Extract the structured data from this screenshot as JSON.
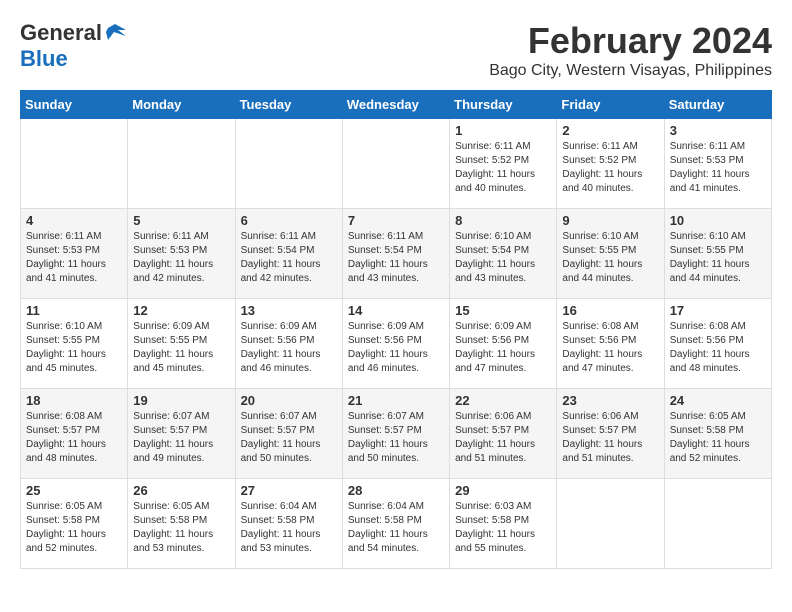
{
  "header": {
    "logo_general": "General",
    "logo_blue": "Blue",
    "month_title": "February 2024",
    "location": "Bago City, Western Visayas, Philippines"
  },
  "days_of_week": [
    "Sunday",
    "Monday",
    "Tuesday",
    "Wednesday",
    "Thursday",
    "Friday",
    "Saturday"
  ],
  "weeks": [
    [
      {
        "day": "",
        "info": ""
      },
      {
        "day": "",
        "info": ""
      },
      {
        "day": "",
        "info": ""
      },
      {
        "day": "",
        "info": ""
      },
      {
        "day": "1",
        "info": "Sunrise: 6:11 AM\nSunset: 5:52 PM\nDaylight: 11 hours\nand 40 minutes."
      },
      {
        "day": "2",
        "info": "Sunrise: 6:11 AM\nSunset: 5:52 PM\nDaylight: 11 hours\nand 40 minutes."
      },
      {
        "day": "3",
        "info": "Sunrise: 6:11 AM\nSunset: 5:53 PM\nDaylight: 11 hours\nand 41 minutes."
      }
    ],
    [
      {
        "day": "4",
        "info": "Sunrise: 6:11 AM\nSunset: 5:53 PM\nDaylight: 11 hours\nand 41 minutes."
      },
      {
        "day": "5",
        "info": "Sunrise: 6:11 AM\nSunset: 5:53 PM\nDaylight: 11 hours\nand 42 minutes."
      },
      {
        "day": "6",
        "info": "Sunrise: 6:11 AM\nSunset: 5:54 PM\nDaylight: 11 hours\nand 42 minutes."
      },
      {
        "day": "7",
        "info": "Sunrise: 6:11 AM\nSunset: 5:54 PM\nDaylight: 11 hours\nand 43 minutes."
      },
      {
        "day": "8",
        "info": "Sunrise: 6:10 AM\nSunset: 5:54 PM\nDaylight: 11 hours\nand 43 minutes."
      },
      {
        "day": "9",
        "info": "Sunrise: 6:10 AM\nSunset: 5:55 PM\nDaylight: 11 hours\nand 44 minutes."
      },
      {
        "day": "10",
        "info": "Sunrise: 6:10 AM\nSunset: 5:55 PM\nDaylight: 11 hours\nand 44 minutes."
      }
    ],
    [
      {
        "day": "11",
        "info": "Sunrise: 6:10 AM\nSunset: 5:55 PM\nDaylight: 11 hours\nand 45 minutes."
      },
      {
        "day": "12",
        "info": "Sunrise: 6:09 AM\nSunset: 5:55 PM\nDaylight: 11 hours\nand 45 minutes."
      },
      {
        "day": "13",
        "info": "Sunrise: 6:09 AM\nSunset: 5:56 PM\nDaylight: 11 hours\nand 46 minutes."
      },
      {
        "day": "14",
        "info": "Sunrise: 6:09 AM\nSunset: 5:56 PM\nDaylight: 11 hours\nand 46 minutes."
      },
      {
        "day": "15",
        "info": "Sunrise: 6:09 AM\nSunset: 5:56 PM\nDaylight: 11 hours\nand 47 minutes."
      },
      {
        "day": "16",
        "info": "Sunrise: 6:08 AM\nSunset: 5:56 PM\nDaylight: 11 hours\nand 47 minutes."
      },
      {
        "day": "17",
        "info": "Sunrise: 6:08 AM\nSunset: 5:56 PM\nDaylight: 11 hours\nand 48 minutes."
      }
    ],
    [
      {
        "day": "18",
        "info": "Sunrise: 6:08 AM\nSunset: 5:57 PM\nDaylight: 11 hours\nand 48 minutes."
      },
      {
        "day": "19",
        "info": "Sunrise: 6:07 AM\nSunset: 5:57 PM\nDaylight: 11 hours\nand 49 minutes."
      },
      {
        "day": "20",
        "info": "Sunrise: 6:07 AM\nSunset: 5:57 PM\nDaylight: 11 hours\nand 50 minutes."
      },
      {
        "day": "21",
        "info": "Sunrise: 6:07 AM\nSunset: 5:57 PM\nDaylight: 11 hours\nand 50 minutes."
      },
      {
        "day": "22",
        "info": "Sunrise: 6:06 AM\nSunset: 5:57 PM\nDaylight: 11 hours\nand 51 minutes."
      },
      {
        "day": "23",
        "info": "Sunrise: 6:06 AM\nSunset: 5:57 PM\nDaylight: 11 hours\nand 51 minutes."
      },
      {
        "day": "24",
        "info": "Sunrise: 6:05 AM\nSunset: 5:58 PM\nDaylight: 11 hours\nand 52 minutes."
      }
    ],
    [
      {
        "day": "25",
        "info": "Sunrise: 6:05 AM\nSunset: 5:58 PM\nDaylight: 11 hours\nand 52 minutes."
      },
      {
        "day": "26",
        "info": "Sunrise: 6:05 AM\nSunset: 5:58 PM\nDaylight: 11 hours\nand 53 minutes."
      },
      {
        "day": "27",
        "info": "Sunrise: 6:04 AM\nSunset: 5:58 PM\nDaylight: 11 hours\nand 53 minutes."
      },
      {
        "day": "28",
        "info": "Sunrise: 6:04 AM\nSunset: 5:58 PM\nDaylight: 11 hours\nand 54 minutes."
      },
      {
        "day": "29",
        "info": "Sunrise: 6:03 AM\nSunset: 5:58 PM\nDaylight: 11 hours\nand 55 minutes."
      },
      {
        "day": "",
        "info": ""
      },
      {
        "day": "",
        "info": ""
      }
    ]
  ]
}
